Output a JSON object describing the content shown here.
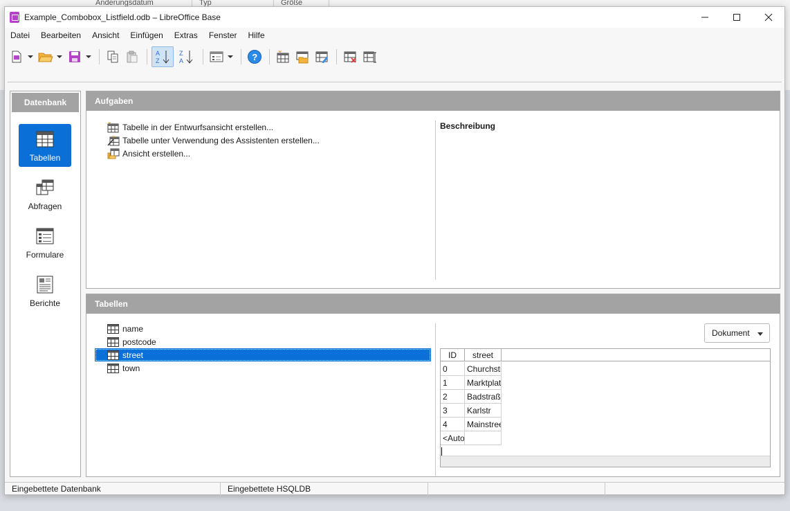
{
  "background_window": {
    "columns": [
      "Änderungsdatum",
      "Typ",
      "Größe"
    ]
  },
  "window": {
    "title": "Example_Combobox_Listfield.odb – LibreOffice Base"
  },
  "menubar": {
    "items": [
      "Datei",
      "Bearbeiten",
      "Ansicht",
      "Einfügen",
      "Extras",
      "Fenster",
      "Hilfe"
    ]
  },
  "left_panel": {
    "header": "Datenbank",
    "items": [
      {
        "label": "Tabellen",
        "selected": true
      },
      {
        "label": "Abfragen",
        "selected": false
      },
      {
        "label": "Formulare",
        "selected": false
      },
      {
        "label": "Berichte",
        "selected": false
      }
    ]
  },
  "tasks_panel": {
    "header": "Aufgaben",
    "tasks": [
      "Tabelle in der Entwurfsansicht erstellen...",
      "Tabelle unter Verwendung des Assistenten erstellen...",
      "Ansicht erstellen..."
    ],
    "description_label": "Beschreibung"
  },
  "tables_panel": {
    "header": "Tabellen",
    "tables": [
      {
        "name": "name",
        "selected": false
      },
      {
        "name": "postcode",
        "selected": false
      },
      {
        "name": "street",
        "selected": true
      },
      {
        "name": "town",
        "selected": false
      }
    ],
    "preview_mode": "Dokument",
    "preview": {
      "columns": [
        "ID",
        "street"
      ],
      "rows": [
        [
          "0",
          "Churchstr"
        ],
        [
          "1",
          "Marktplatz"
        ],
        [
          "2",
          "Badstraße"
        ],
        [
          "3",
          "Karlstr"
        ],
        [
          "4",
          "Mainstreet"
        ],
        [
          "<AutoField>",
          ""
        ]
      ]
    }
  },
  "statusbar": {
    "cells": [
      "Eingebettete Datenbank",
      "Eingebettete HSQLDB",
      "",
      ""
    ]
  },
  "colors": {
    "accent": "#0a6fd6",
    "panel_header": "#a3a3a3",
    "app_icon": "#b244c5"
  }
}
